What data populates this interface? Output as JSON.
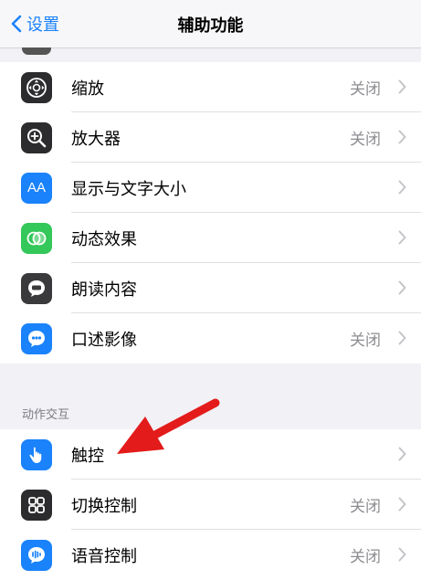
{
  "nav": {
    "back_label": "设置",
    "title": "辅助功能"
  },
  "group1": [
    {
      "label": "缩放",
      "value": "关闭",
      "icon": "zoom-icon",
      "color": "#2c2c2e"
    },
    {
      "label": "放大器",
      "value": "关闭",
      "icon": "magnifier-icon",
      "color": "#2c2c2e"
    },
    {
      "label": "显示与文字大小",
      "value": "",
      "icon": "text-size-icon",
      "icon_text": "AA",
      "color": "#1a82fb"
    },
    {
      "label": "动态效果",
      "value": "",
      "icon": "motion-icon",
      "color": "#34c759"
    },
    {
      "label": "朗读内容",
      "value": "",
      "icon": "spoken-content-icon",
      "color": "#3a3a3c"
    },
    {
      "label": "口述影像",
      "value": "关闭",
      "icon": "audio-description-icon",
      "color": "#1a82fb"
    }
  ],
  "section2_header": "动作交互",
  "group2": [
    {
      "label": "触控",
      "value": "",
      "icon": "touch-icon",
      "color": "#1a82fb"
    },
    {
      "label": "切换控制",
      "value": "关闭",
      "icon": "switch-control-icon",
      "color": "#2c2c2e"
    },
    {
      "label": "语音控制",
      "value": "关闭",
      "icon": "voice-control-icon",
      "color": "#1a82fb"
    }
  ],
  "colors": {
    "accent": "#1a82fb",
    "annotation_arrow": "#e31b1b",
    "background": "#f1f1f6"
  }
}
